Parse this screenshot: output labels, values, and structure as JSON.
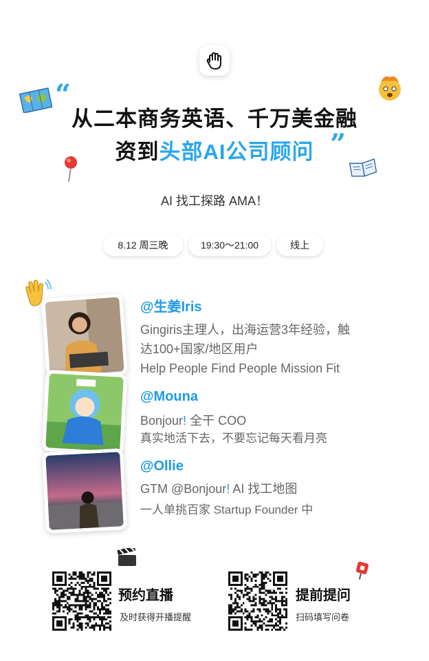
{
  "header": {
    "icon": "waving-hand-icon",
    "title_line1": "从二本商务英语、千万美金融",
    "title_line2_prefix": "资到",
    "title_line2_highlight": "头部AI公司顾问",
    "open_quote": "“",
    "close_quote": "”",
    "subtitle": "AI 找工探路 AMA！"
  },
  "pills": {
    "date": "8.12 周三晚",
    "time": "19:30～21:00",
    "mode": "线上"
  },
  "speakers": [
    {
      "handle": "@生姜Iris",
      "desc_line1": "Gingiris主理人，出海运营3年经验，触",
      "desc_line2": "达100+国家/地区用户",
      "desc_line3": "Help People Find People Mission Fit"
    },
    {
      "handle": "@Mouna",
      "desc_line1_a": "Bonjour",
      "desc_line1_ex": "!",
      "desc_line1_b": " 全干 COO",
      "desc_line2": "真实地活下去，不要忘记每天看月亮"
    },
    {
      "handle": "@Ollie",
      "desc_line1_a": "GTM @Bonjour",
      "desc_line1_ex": "!",
      "desc_line1_b": " AI 找工地图",
      "desc_line2": "一人单挑百家 Startup Founder 中"
    }
  ],
  "qr": {
    "left": {
      "title": "预约直播",
      "sub": "及时获得开播提醒"
    },
    "right": {
      "title": "提前提问",
      "sub": "扫码填写问卷"
    }
  },
  "decorations": [
    "world-map-icon",
    "exploding-head-icon",
    "pushpin-icon",
    "open-book-icon",
    "waving-hand-icon",
    "clapper-board-icon",
    "red-flag-icon"
  ],
  "colors": {
    "accent": "#2aa6ee",
    "handle": "#1e9be8",
    "text_gray": "#666666"
  }
}
